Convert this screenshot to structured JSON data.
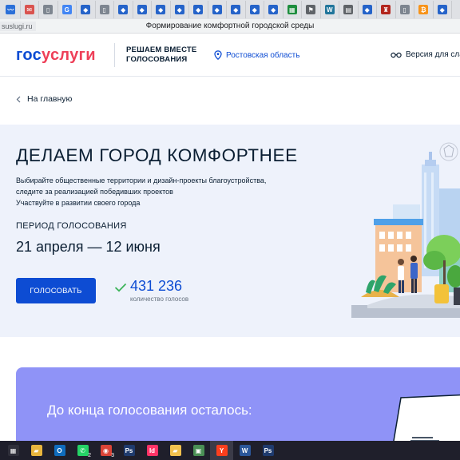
{
  "browser": {
    "tabs": [
      {
        "icon": "wave-icon",
        "glyph": "〰",
        "color": "#2b6fd8"
      },
      {
        "icon": "mail-icon",
        "glyph": "✉",
        "color": "#d9534f"
      },
      {
        "icon": "doc-icon",
        "glyph": "▯",
        "color": "#7d8590"
      },
      {
        "icon": "google-icon",
        "glyph": "G",
        "color": "#4285f4"
      },
      {
        "icon": "gosuslugi-icon",
        "glyph": "◆",
        "color": "#2563c9"
      },
      {
        "icon": "doc-icon",
        "glyph": "▯",
        "color": "#7d8590"
      },
      {
        "icon": "gosuslugi-icon",
        "glyph": "◆",
        "color": "#2563c9"
      },
      {
        "icon": "gosuslugi-icon",
        "glyph": "◆",
        "color": "#2563c9"
      },
      {
        "icon": "gosuslugi-icon",
        "glyph": "◆",
        "color": "#2563c9"
      },
      {
        "icon": "gosuslugi-icon",
        "glyph": "◆",
        "color": "#2563c9"
      },
      {
        "icon": "gosuslugi-icon",
        "glyph": "◆",
        "color": "#2563c9"
      },
      {
        "icon": "gosuslugi-icon",
        "glyph": "◆",
        "color": "#2563c9"
      },
      {
        "icon": "gosuslugi-icon",
        "glyph": "◆",
        "color": "#2563c9"
      },
      {
        "icon": "gosuslugi-icon",
        "glyph": "◆",
        "color": "#2563c9"
      },
      {
        "icon": "gosuslugi-icon",
        "glyph": "◆",
        "color": "#2563c9"
      },
      {
        "icon": "spreadsheet-icon",
        "glyph": "▦",
        "color": "#1e8e3e"
      },
      {
        "icon": "flag-icon",
        "glyph": "⚑",
        "color": "#5f6368"
      },
      {
        "icon": "wordpress-icon",
        "glyph": "W",
        "color": "#21759b"
      },
      {
        "icon": "grid-icon",
        "glyph": "▤",
        "color": "#5f6368"
      },
      {
        "icon": "gosuslugi-icon",
        "glyph": "◆",
        "color": "#2563c9"
      },
      {
        "icon": "emblem-icon",
        "glyph": "♜",
        "color": "#b3261e"
      },
      {
        "icon": "doc-icon",
        "glyph": "▯",
        "color": "#7d8590"
      },
      {
        "icon": "bitcoin-icon",
        "glyph": "₿",
        "color": "#f7931a"
      },
      {
        "icon": "gosuslugi-icon",
        "glyph": "◆",
        "color": "#2563c9"
      }
    ],
    "url": "suslugi.ru",
    "title": "Формирование комфортной городской среды"
  },
  "header": {
    "logo_part1": "гос",
    "logo_part2": "услуги",
    "tagline_line1": "РЕШАЕМ ВМЕСТЕ",
    "tagline_line2": "ГОЛОСОВАНИЯ",
    "region": "Ростовская область",
    "accessibility": "Версия для слаб"
  },
  "back_link": "На главную",
  "hero": {
    "title": "ДЕЛАЕМ ГОРОД КОМФОРТНЕЕ",
    "desc_line1": "Выбирайте общественные территории и дизайн-проекты благоустройства,",
    "desc_line2": "следите за реализацией победивших проектов",
    "desc_line3": "Участвуйте в развитии своего города",
    "period_label": "ПЕРИОД ГОЛОСОВАНИЯ",
    "period_dates": "21 апреля — 12 июня",
    "vote_button": "ГОЛОСОВАТЬ",
    "votes_count": "431 236",
    "votes_label": "количество голосов"
  },
  "countdown": {
    "title": "До конца голосования осталось:"
  },
  "taskbar": {
    "items": [
      {
        "icon": "windows-icon",
        "glyph": "▦",
        "color": "#2f2f3a",
        "active": false
      },
      {
        "icon": "folder-icon",
        "glyph": "▰",
        "color": "#e8b53d",
        "active": false
      },
      {
        "icon": "outlook-icon",
        "glyph": "O",
        "color": "#0f6cbd",
        "active": false
      },
      {
        "icon": "whatsapp-icon",
        "glyph": "✆",
        "color": "#25d366",
        "active": false,
        "badge": "2"
      },
      {
        "icon": "chrome-icon",
        "glyph": "◉",
        "color": "#db4437",
        "active": false,
        "badge": "3"
      },
      {
        "icon": "photoshop-icon",
        "glyph": "Ps",
        "color": "#1f3b6e",
        "active": false
      },
      {
        "icon": "indesign-icon",
        "glyph": "Id",
        "color": "#ff3366",
        "active": false
      },
      {
        "icon": "file-explorer-icon",
        "glyph": "▰",
        "color": "#f2c14e",
        "active": false
      },
      {
        "icon": "image-viewer-icon",
        "glyph": "▣",
        "color": "#4a8f55",
        "active": false
      },
      {
        "icon": "yandex-browser-icon",
        "glyph": "Y",
        "color": "#fc3f1d",
        "active": true
      },
      {
        "icon": "word-icon",
        "glyph": "W",
        "color": "#2b579a",
        "active": false
      },
      {
        "icon": "photoshop-icon",
        "glyph": "Ps",
        "color": "#1f3b6e",
        "active": false
      }
    ]
  }
}
